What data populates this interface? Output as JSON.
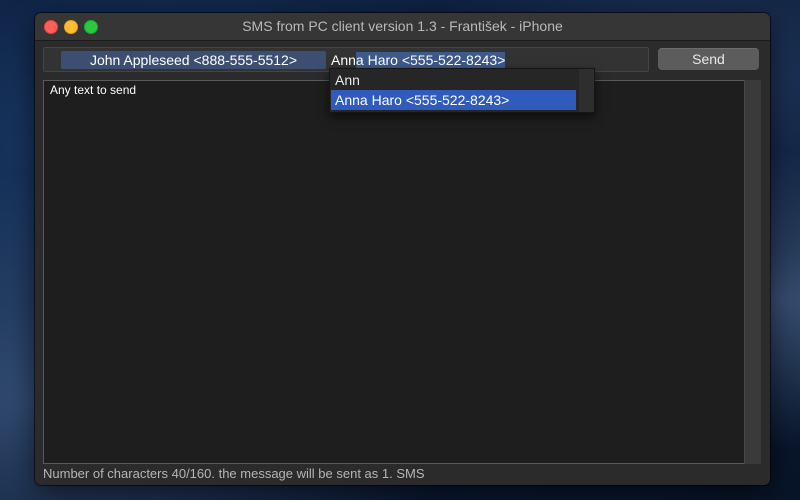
{
  "window": {
    "title": "SMS from PC client version 1.3 - František - iPhone"
  },
  "recipients": {
    "token": "John Appleseed <888-555-5512>",
    "typed_prefix": "Ann",
    "autocomplete_suffix": "a Haro <555-522-8243>"
  },
  "send_button": {
    "label": "Send"
  },
  "message": {
    "text": "Any text to send"
  },
  "status": {
    "text": "Number of characters 40/160. the message will be sent as 1. SMS"
  },
  "autocomplete": {
    "items": [
      {
        "label": "Ann"
      },
      {
        "label": "Anna Haro <555-522-8243>",
        "selected": true
      }
    ]
  },
  "colors": {
    "selection_highlight": "#2f5bbd",
    "token_background": "#3d4f70"
  }
}
